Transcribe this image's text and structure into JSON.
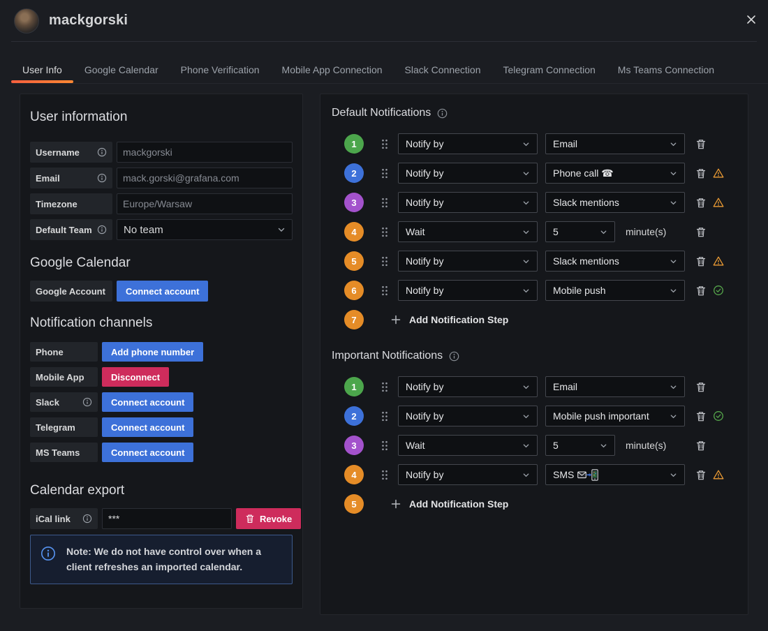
{
  "window": {
    "title": "mackgorski"
  },
  "tabs": [
    {
      "label": "User Info"
    },
    {
      "label": "Google Calendar"
    },
    {
      "label": "Phone Verification"
    },
    {
      "label": "Mobile App Connection"
    },
    {
      "label": "Slack Connection"
    },
    {
      "label": "Telegram Connection"
    },
    {
      "label": "Ms Teams Connection"
    }
  ],
  "left": {
    "user_info_title": "User information",
    "fields": [
      {
        "label": "Username",
        "value": "mackgorski"
      },
      {
        "label": "Email",
        "value": "mack.gorski@grafana.com"
      },
      {
        "label": "Timezone",
        "value": "Europe/Warsaw"
      },
      {
        "label": "Default Team",
        "value": "No team"
      }
    ],
    "google_calendar_title": "Google Calendar",
    "google_account_label": "Google Account",
    "google_account_button": "Connect account",
    "channels_title": "Notification channels",
    "channels": [
      {
        "label": "Phone",
        "button": "Add phone number"
      },
      {
        "label": "Mobile App",
        "button": "Disconnect"
      },
      {
        "label": "Slack",
        "button": "Connect account"
      },
      {
        "label": "Telegram",
        "button": "Connect account"
      },
      {
        "label": "MS Teams",
        "button": "Connect account"
      }
    ],
    "calendar_export_title": "Calendar export",
    "ical_label": "iCal link",
    "ical_value": "***",
    "revoke_button": "Revoke",
    "note_text": "Note: We do not have control over when a client refreshes an imported calendar."
  },
  "right": {
    "default_title": "Default Notifications",
    "default_steps": [
      {
        "num": "1",
        "action": "Notify by",
        "value": "Email"
      },
      {
        "num": "2",
        "action": "Notify by",
        "value": "Phone call ☎"
      },
      {
        "num": "3",
        "action": "Notify by",
        "value": "Slack mentions"
      },
      {
        "num": "4",
        "action": "Wait",
        "value": "5",
        "suffix": "minute(s)"
      },
      {
        "num": "5",
        "action": "Notify by",
        "value": "Slack mentions"
      },
      {
        "num": "6",
        "action": "Notify by",
        "value": "Mobile push"
      }
    ],
    "default_next_num": "7",
    "add_step_label": "Add Notification Step",
    "important_title": "Important Notifications",
    "important_steps": [
      {
        "num": "1",
        "action": "Notify by",
        "value": "Email"
      },
      {
        "num": "2",
        "action": "Notify by",
        "value": "Mobile push important"
      },
      {
        "num": "3",
        "action": "Wait",
        "value": "5",
        "suffix": "minute(s)"
      },
      {
        "num": "4",
        "action": "Notify by",
        "value": "SMS"
      }
    ],
    "important_next_num": "5"
  },
  "colors": {
    "accent_orange": "#ff7d33",
    "primary_blue": "#3d71d9",
    "destructive_red": "#ce2c5c",
    "step_green": "#4ca64c",
    "step_blue": "#3d71d9",
    "step_purple": "#a352cc",
    "step_orange": "#e58c27",
    "warning_orange": "#eb9b34",
    "success_green": "#56a64b",
    "info_blue": "#5794f2"
  }
}
